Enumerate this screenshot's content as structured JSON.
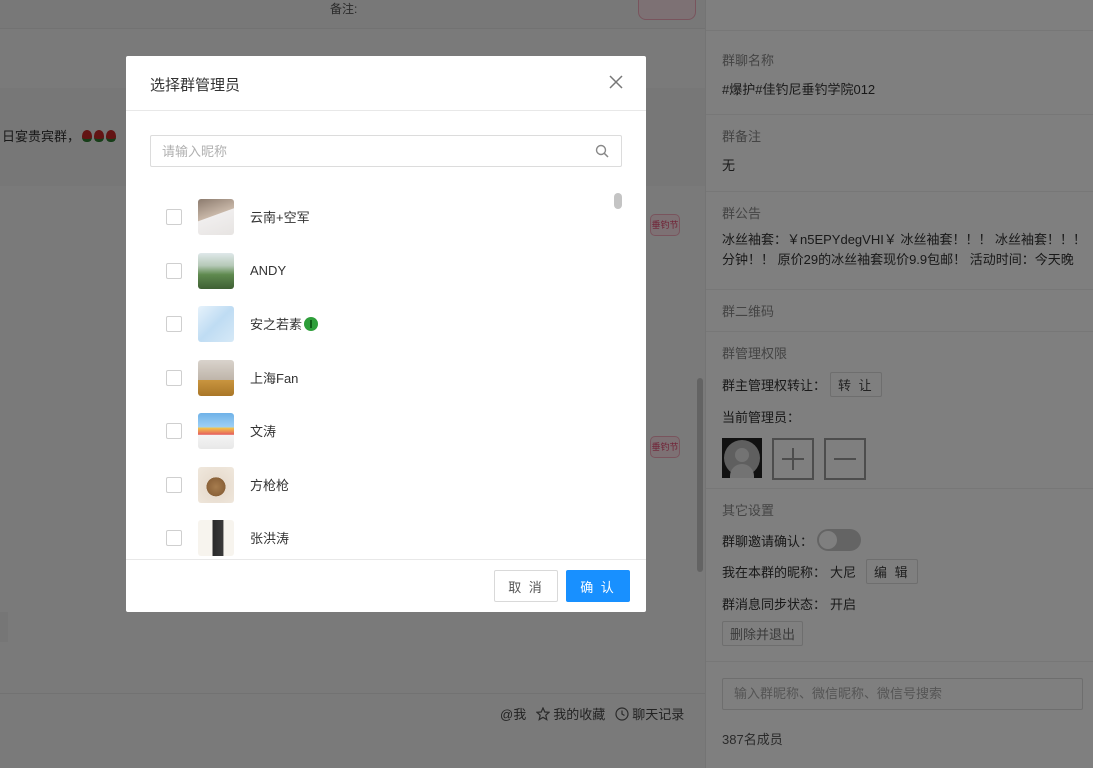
{
  "chat": {
    "note_label": "备注:",
    "message_text": "日宴贵宾群，",
    "shop_badge": "垂钓节",
    "toolbar": {
      "at_me": "@我",
      "favorites": "我的收藏",
      "history": "聊天记录"
    }
  },
  "panel": {
    "group_name_label": "群聊名称",
    "group_name": "#爆护#佳钓尼垂钓学院012",
    "remark_label": "群备注",
    "remark_value": "无",
    "notice_label": "群公告",
    "notice_line1": "冰丝袖套：￥n5EPYdegVHI￥ 冰丝袖套！！！ 冰丝袖套！！！",
    "notice_line2": "分钟！！ 原价29的冰丝袖套现价9.9包邮！ 活动时间：今天晚",
    "qrcode_label": "群二维码",
    "admin_label": "群管理权限",
    "owner_transfer_label": "群主管理权转让：",
    "transfer_button": "转 让",
    "current_admins_label": "当前管理员：",
    "other_settings_label": "其它设置",
    "invite_confirm_label": "群聊邀请确认：",
    "my_nickname_label": "我在本群的昵称：",
    "my_nickname": "大尼",
    "edit_button": "编 辑",
    "sync_label": "群消息同步状态：",
    "sync_value": "开启",
    "delete_exit_button": "删除并退出",
    "member_search_placeholder": "输入群昵称、微信昵称、微信号搜索",
    "member_count": "387名成员"
  },
  "modal": {
    "title": "选择群管理员",
    "search_placeholder": "请输入昵称",
    "members": [
      {
        "name": "云南+空军"
      },
      {
        "name": "ANDY"
      },
      {
        "name": "安之若素"
      },
      {
        "name": "上海Fan"
      },
      {
        "name": "文涛"
      },
      {
        "name": "方枪枪"
      },
      {
        "name": "张洪涛"
      }
    ],
    "cancel_label": "取 消",
    "confirm_label": "确 认"
  },
  "colors": {
    "primary": "#1890ff",
    "overlay": "rgba(0,0,0,0.5)"
  }
}
